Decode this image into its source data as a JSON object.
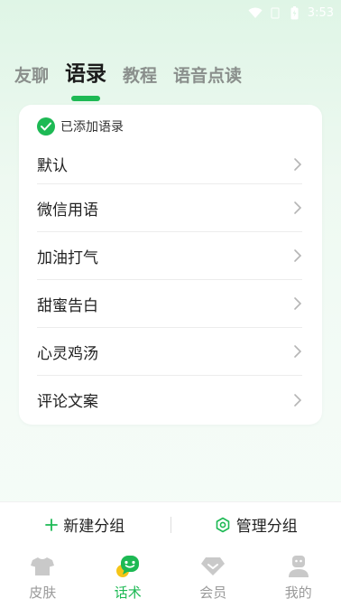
{
  "status_bar": {
    "time": "3:53",
    "icons": [
      "wifi-icon",
      "sim-icon",
      "battery-icon"
    ]
  },
  "tabs": [
    {
      "label": "友聊",
      "active": false
    },
    {
      "label": "语录",
      "active": true
    },
    {
      "label": "教程",
      "active": false
    },
    {
      "label": "语音点读",
      "active": false
    }
  ],
  "card": {
    "header": "已添加语录",
    "items": [
      {
        "label": "默认"
      },
      {
        "label": "微信用语"
      },
      {
        "label": "加油打气"
      },
      {
        "label": "甜蜜告白"
      },
      {
        "label": "心灵鸡汤"
      },
      {
        "label": "评论文案"
      }
    ]
  },
  "actions": {
    "new_group": "新建分组",
    "manage_group": "管理分组"
  },
  "tabbar": [
    {
      "label": "皮肤",
      "icon": "shirt-icon",
      "active": false
    },
    {
      "label": "话术",
      "icon": "chat-icon",
      "active": true
    },
    {
      "label": "会员",
      "icon": "diamond-icon",
      "active": false
    },
    {
      "label": "我的",
      "icon": "profile-icon",
      "active": false
    }
  ],
  "colors": {
    "accent": "#1db954",
    "inactive": "#9a9a9a"
  }
}
